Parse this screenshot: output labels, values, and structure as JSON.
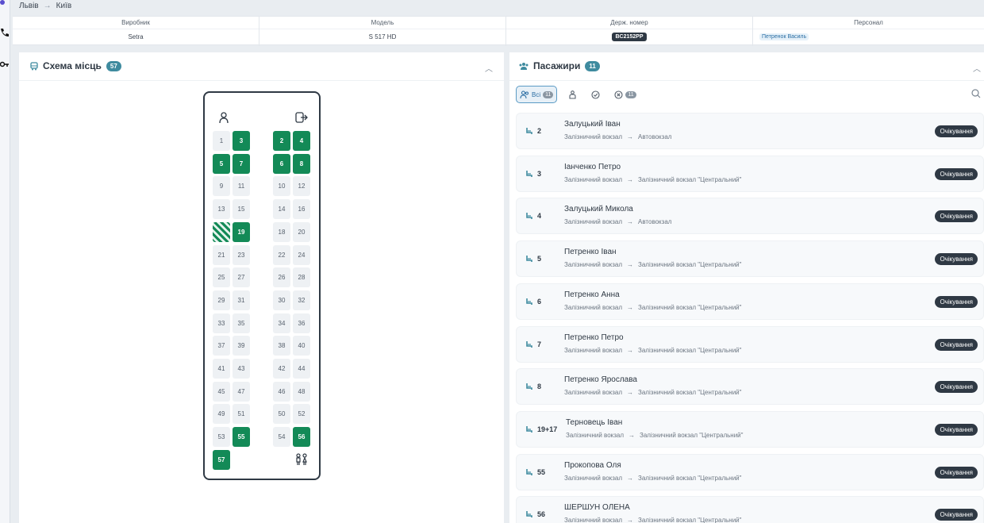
{
  "breadcrumb": {
    "from": "Львів",
    "to": "Київ"
  },
  "info": {
    "headers": [
      "Виробник",
      "Модель",
      "Держ. номер",
      "Персонал"
    ],
    "manufacturer": "Setra",
    "model": "S 517 HD",
    "plate": "BC2152PP",
    "staff": "Петренок Василь"
  },
  "seat_panel": {
    "title": "Схема місць",
    "count": "57"
  },
  "passengers_panel": {
    "title": "Пасажири",
    "count": "11",
    "filters": {
      "all_label": "Всі",
      "all_count": "11",
      "cancelled_count": "11"
    }
  },
  "seats": [
    {
      "n": "1",
      "s": "free"
    },
    {
      "n": "3",
      "s": "occ"
    },
    {
      "n": "2",
      "s": "occ"
    },
    {
      "n": "4",
      "s": "occ"
    },
    {
      "n": "5",
      "s": "occ"
    },
    {
      "n": "7",
      "s": "occ"
    },
    {
      "n": "6",
      "s": "occ"
    },
    {
      "n": "8",
      "s": "occ"
    },
    {
      "n": "9",
      "s": "free"
    },
    {
      "n": "11",
      "s": "free"
    },
    {
      "n": "10",
      "s": "free"
    },
    {
      "n": "12",
      "s": "free"
    },
    {
      "n": "13",
      "s": "free"
    },
    {
      "n": "15",
      "s": "free"
    },
    {
      "n": "14",
      "s": "free"
    },
    {
      "n": "16",
      "s": "free"
    },
    {
      "n": "",
      "s": "hatch"
    },
    {
      "n": "19",
      "s": "occ"
    },
    {
      "n": "18",
      "s": "free"
    },
    {
      "n": "20",
      "s": "free"
    },
    {
      "n": "21",
      "s": "free"
    },
    {
      "n": "23",
      "s": "free"
    },
    {
      "n": "22",
      "s": "free"
    },
    {
      "n": "24",
      "s": "free"
    },
    {
      "n": "25",
      "s": "free"
    },
    {
      "n": "27",
      "s": "free"
    },
    {
      "n": "26",
      "s": "free"
    },
    {
      "n": "28",
      "s": "free"
    },
    {
      "n": "29",
      "s": "free"
    },
    {
      "n": "31",
      "s": "free"
    },
    {
      "n": "30",
      "s": "free"
    },
    {
      "n": "32",
      "s": "free"
    },
    {
      "n": "33",
      "s": "free"
    },
    {
      "n": "35",
      "s": "free"
    },
    {
      "n": "34",
      "s": "free"
    },
    {
      "n": "36",
      "s": "free"
    },
    {
      "n": "37",
      "s": "free"
    },
    {
      "n": "39",
      "s": "free"
    },
    {
      "n": "38",
      "s": "free"
    },
    {
      "n": "40",
      "s": "free"
    },
    {
      "n": "41",
      "s": "free"
    },
    {
      "n": "43",
      "s": "free"
    },
    {
      "n": "42",
      "s": "free"
    },
    {
      "n": "44",
      "s": "free"
    },
    {
      "n": "45",
      "s": "free"
    },
    {
      "n": "47",
      "s": "free"
    },
    {
      "n": "46",
      "s": "free"
    },
    {
      "n": "48",
      "s": "free"
    },
    {
      "n": "49",
      "s": "free"
    },
    {
      "n": "51",
      "s": "free"
    },
    {
      "n": "50",
      "s": "free"
    },
    {
      "n": "52",
      "s": "free"
    },
    {
      "n": "53",
      "s": "free"
    },
    {
      "n": "55",
      "s": "occ"
    },
    {
      "n": "54",
      "s": "free"
    },
    {
      "n": "56",
      "s": "occ"
    },
    {
      "n": "57",
      "s": "occ"
    }
  ],
  "passengers": [
    {
      "seat": "2",
      "name": "Залуцький Іван",
      "from": "Залізничний вокзал",
      "to": "Автовокзал",
      "status": "Очікування"
    },
    {
      "seat": "3",
      "name": "Іанченко Петро",
      "from": "Залізничний вокзал",
      "to": "Залізничний вокзал \"Центральний\"",
      "status": "Очікування"
    },
    {
      "seat": "4",
      "name": "Залуцький Микола",
      "from": "Залізничний вокзал",
      "to": "Автовокзал",
      "status": "Очікування"
    },
    {
      "seat": "5",
      "name": "Петренко Іван",
      "from": "Залізничний вокзал",
      "to": "Залізничний вокзал \"Центральний\"",
      "status": "Очікування"
    },
    {
      "seat": "6",
      "name": "Петренко Анна",
      "from": "Залізничний вокзал",
      "to": "Залізничний вокзал \"Центральний\"",
      "status": "Очікування"
    },
    {
      "seat": "7",
      "name": "Петренко Петро",
      "from": "Залізничний вокзал",
      "to": "Залізничний вокзал \"Центральний\"",
      "status": "Очікування"
    },
    {
      "seat": "8",
      "name": "Петренко Ярослава",
      "from": "Залізничний вокзал",
      "to": "Залізничний вокзал \"Центральний\"",
      "status": "Очікування"
    },
    {
      "seat": "19+17",
      "name": "Терновець Іван",
      "from": "Залізничний вокзал",
      "to": "Залізничний вокзал \"Центральний\"",
      "status": "Очікування"
    },
    {
      "seat": "55",
      "name": "Прокопова Оля",
      "from": "Залізничний вокзал",
      "to": "Залізничний вокзал \"Центральний\"",
      "status": "Очікування"
    },
    {
      "seat": "56",
      "name": "ШЕРШУН ОЛЕНА",
      "from": "Залізничний вокзал",
      "to": "Залізничний вокзал \"Центральний\"",
      "status": "Очікування"
    }
  ]
}
